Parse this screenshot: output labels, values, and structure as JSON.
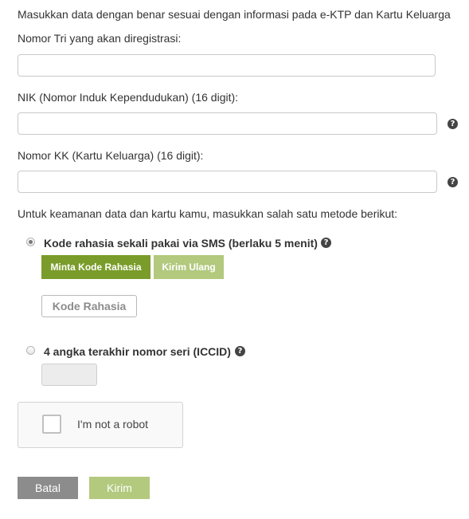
{
  "intro_text": "Masukkan data dengan benar sesuai dengan informasi pada e-KTP dan Kartu Keluarga",
  "phone": {
    "label": "Nomor Tri yang akan diregistrasi:",
    "value": ""
  },
  "nik": {
    "label": "NIK (Nomor Induk Kependudukan) (16 digit):",
    "value": "",
    "help_icon": "question-circle-icon"
  },
  "kk": {
    "label": "Nomor KK (Kartu Keluarga) (16 digit):",
    "value": "",
    "help_icon": "question-circle-icon"
  },
  "security_text": "Untuk keamanan data dan kartu kamu, masukkan salah satu metode berikut:",
  "method_sms": {
    "label": "Kode rahasia sekali pakai via SMS (berlaku 5 menit)",
    "selected": true,
    "request_button": "Minta Kode Rahasia",
    "resend_button": "Kirim Ulang",
    "code_placeholder": "Kode Rahasia"
  },
  "method_iccid": {
    "label": "4 angka terakhir nomor seri (ICCID)",
    "selected": false,
    "value": ""
  },
  "captcha": {
    "label": "I'm not a robot",
    "checked": false
  },
  "actions": {
    "cancel_label": "Batal",
    "submit_label": "Kirim"
  },
  "colors": {
    "primary_green": "#7a9c2a",
    "disabled_green": "#b2c97e",
    "cancel_grey": "#8c8c8c",
    "text": "#333333"
  }
}
